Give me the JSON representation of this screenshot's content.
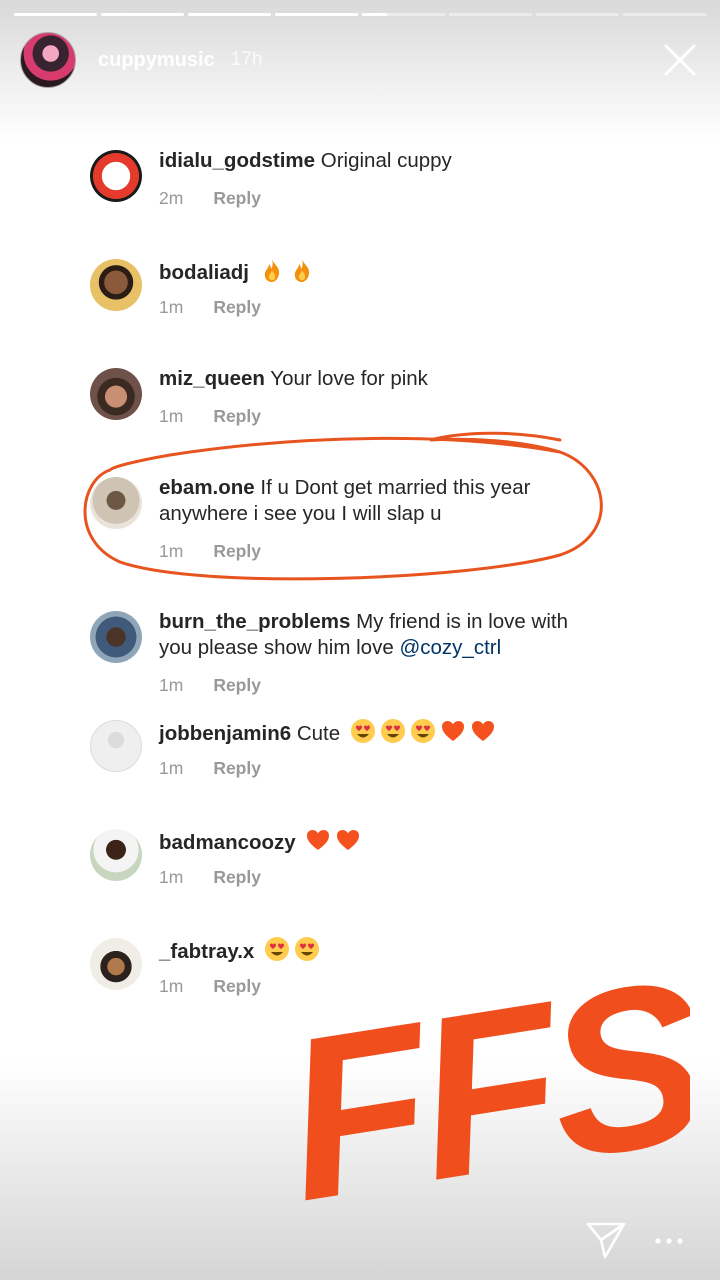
{
  "story": {
    "username": "cuppymusic",
    "time": "17h",
    "progress": {
      "segments": 8,
      "active_index": 4,
      "active_fill": 0.3
    }
  },
  "comments": [
    {
      "username": "idialu_godstime",
      "text": "Original cuppy",
      "emoji": [],
      "mention": "",
      "time": "2m",
      "reply": "Reply",
      "avatar": "esp-logo"
    },
    {
      "username": "bodaliadj",
      "text": "",
      "emoji": [
        "fire",
        "fire"
      ],
      "mention": "",
      "time": "1m",
      "reply": "Reply",
      "avatar": "man-smiling"
    },
    {
      "username": "miz_queen",
      "text": "Your love for pink",
      "emoji": [],
      "mention": "",
      "time": "1m",
      "reply": "Reply",
      "avatar": "woman-bear-ears"
    },
    {
      "username": "ebam.one",
      "text": "If u Dont get married this year anywhere i see you I will slap u",
      "emoji": [],
      "mention": "",
      "time": "1m",
      "reply": "Reply",
      "avatar": "man-portrait"
    },
    {
      "username": "burn_the_problems",
      "text": "My friend is in love with you please show him love",
      "emoji": [],
      "mention": "@cozy_ctrl",
      "time": "1m",
      "reply": "Reply",
      "avatar": "man-outdoors"
    },
    {
      "username": "jobbenjamin6",
      "text": "Cute",
      "emoji": [
        "heart-eyes",
        "heart-eyes",
        "heart-eyes",
        "orange-heart",
        "orange-heart"
      ],
      "mention": "",
      "time": "1m",
      "reply": "Reply",
      "avatar": "default-avatar"
    },
    {
      "username": "badmancoozy",
      "text": "",
      "emoji": [
        "orange-heart",
        "orange-heart"
      ],
      "mention": "",
      "time": "1m",
      "reply": "Reply",
      "avatar": "man-white-shirt"
    },
    {
      "username": "_fabtray.x",
      "text": "",
      "emoji": [
        "heart-eyes",
        "heart-eyes"
      ],
      "mention": "",
      "time": "1m",
      "reply": "Reply",
      "avatar": "woman-standing"
    }
  ],
  "overlay": {
    "sticker_text": "FFS",
    "color": "#f04e1d",
    "highlight_color": "#e8541f"
  },
  "footer": {
    "icons": [
      "send-icon",
      "more-icon"
    ]
  }
}
